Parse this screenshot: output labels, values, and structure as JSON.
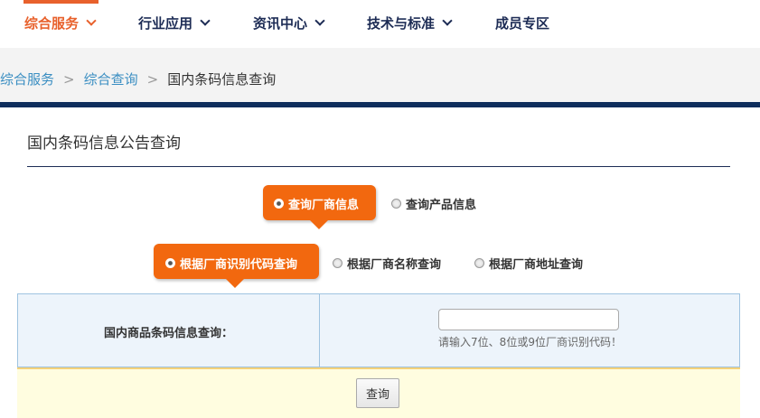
{
  "nav": {
    "items": [
      {
        "label": "综合服务",
        "active": true
      },
      {
        "label": "行业应用",
        "active": false
      },
      {
        "label": "资讯中心",
        "active": false
      },
      {
        "label": "技术与标准",
        "active": false
      },
      {
        "label": "成员专区",
        "active": false
      }
    ],
    "accent_color": "#e8612c",
    "text_color": "#1d2c55"
  },
  "breadcrumb": {
    "items": [
      "综合服务",
      "综合查询"
    ],
    "separator": ">",
    "current": "国内条码信息查询"
  },
  "page_title": "国内条码信息公告查询",
  "query_type": {
    "options": [
      "查询厂商信息",
      "查询产品信息"
    ],
    "selected_index": 0
  },
  "search_mode": {
    "options": [
      "根据厂商识别代码查询",
      "根据厂商名称查询",
      "根据厂商地址查询"
    ],
    "selected_index": 0
  },
  "form": {
    "label": "国内商品条码信息查询：",
    "input_value": "",
    "hint": "请输入7位、8位或9位厂商识别代码！"
  },
  "submit_label": "查询",
  "colors": {
    "highlight_pill": "#f2680f",
    "header_bar": "#0e2d5c",
    "link": "#3a8ec2"
  }
}
